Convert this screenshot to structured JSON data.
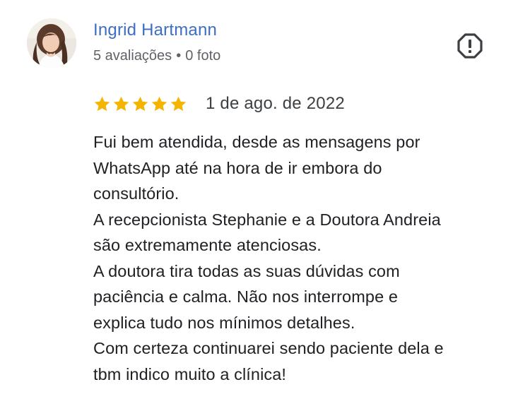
{
  "reviewer": {
    "name": "Ingrid Hartmann",
    "reviews_count": "5 avaliações",
    "separator": "•",
    "photos_count": "0 foto"
  },
  "rating": {
    "stars": 5,
    "star_color": "#f4b400"
  },
  "review": {
    "date": "1 de ago. de 2022",
    "lines": [
      "Fui bem atendida, desde as mensagens por",
      "WhatsApp até na hora de ir embora do",
      "consultório.",
      "A recepcionista Stephanie e a Doutora Andreia",
      "são extremamente atenciosas.",
      "A doutora tira todas as suas dúvidas com",
      "paciência e calma. Não nos interrompe e",
      "explica tudo nos mínimos detalhes.",
      "Com certeza continuarei sendo paciente dela e",
      "tbm indico muito a clínica!"
    ]
  },
  "colors": {
    "name_link": "#3d6dc4",
    "meta_text": "#5f6368",
    "body_text": "#202124",
    "report_icon": "#3c4043"
  },
  "icons": {
    "report": "report-flag-icon",
    "star": "star-icon",
    "avatar": "avatar"
  }
}
